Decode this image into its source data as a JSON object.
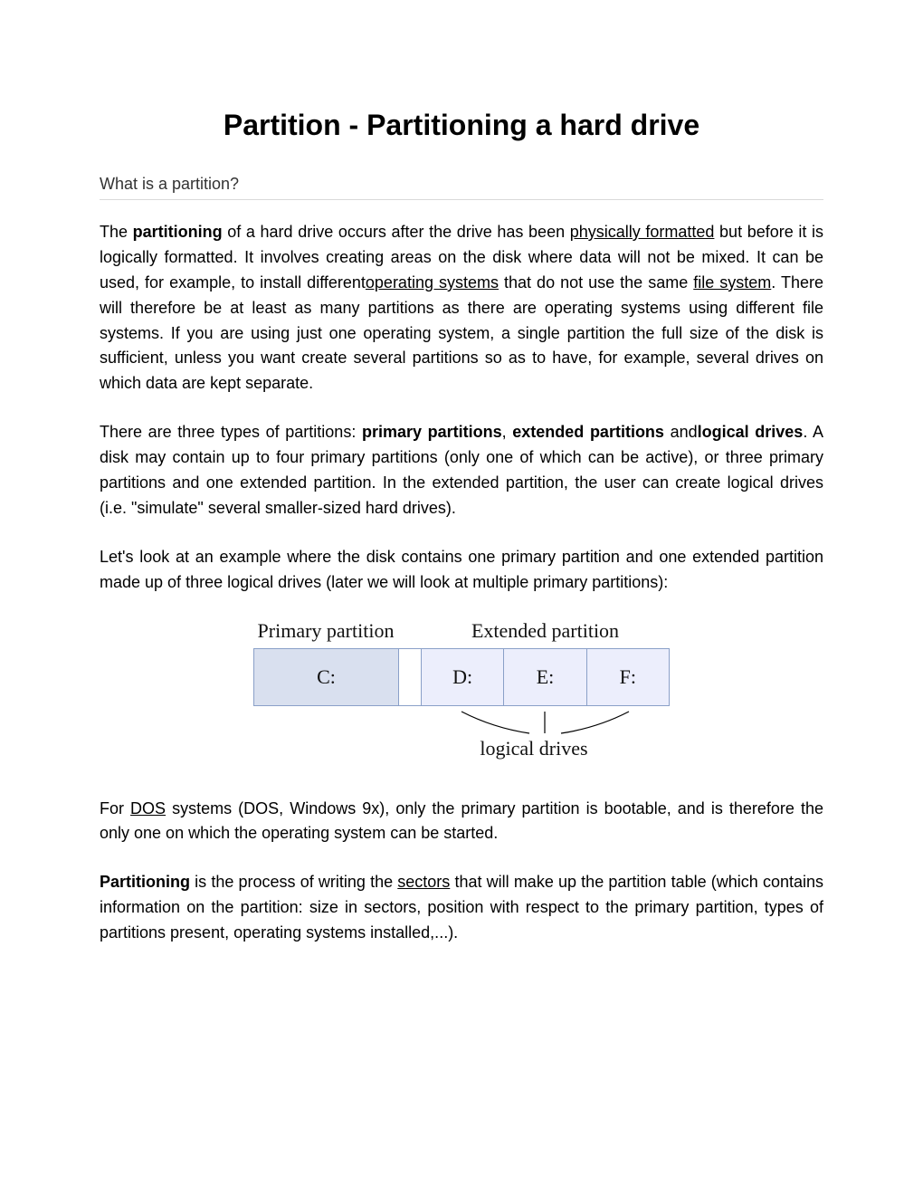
{
  "title": "Partition - Partitioning a hard drive",
  "section_heading": "What is a partition?",
  "p1": {
    "s1": "The ",
    "bold_partitioning": "partitioning",
    "s2": " of a hard drive occurs after the drive has been ",
    "link_phys": "physically formatted",
    "s3": " but before it is logically formatted. It involves creating areas on the disk where data will not be mixed. It can be used, for example, to install different",
    "link_os": "operating systems",
    "s4": " that do not use the same ",
    "link_fs": "file system",
    "s5": ". There will therefore be at least as many partitions as there are operating systems using different file systems. If you are using just one operating system, a single partition the full size of the disk is sufficient, unless you want create several partitions so as to have, for example, several drives on which data are kept separate."
  },
  "p2": {
    "s1": "There are three types of partitions: ",
    "b_primary": "primary partitions",
    "s2": ", ",
    "b_extended": "extended partitions",
    "s3": " and",
    "b_logical": "logical drives",
    "s4": ". A disk may contain up to four primary partitions (only one of which can be active), or three primary partitions and one extended partition. In the extended partition, the user can create logical drives (i.e. \"simulate\" several smaller-sized hard drives)."
  },
  "p3": "Let's look at an example where the disk contains one primary partition and one extended partition made up of three logical drives (later we will look at multiple primary partitions):",
  "diagram": {
    "header_primary": "Primary partition",
    "header_extended": "Extended partition",
    "primary_drive": "C:",
    "logical_drives": [
      "D:",
      "E:",
      "F:"
    ],
    "sub_label": "logical drives"
  },
  "p4": {
    "s1": "For ",
    "link_dos": "DOS",
    "s2": " systems (DOS, Windows 9x), only the primary partition is bootable, and is therefore the only one on which the operating system can be started."
  },
  "p5": {
    "b_part": "Partitioning",
    "s1": " is the process of writing the ",
    "link_sectors": "sectors",
    "s2": " that will make up the partition table (which contains information on the partition: size in sectors, position with respect to the primary partition, types of partitions present, operating systems installed,...)."
  }
}
